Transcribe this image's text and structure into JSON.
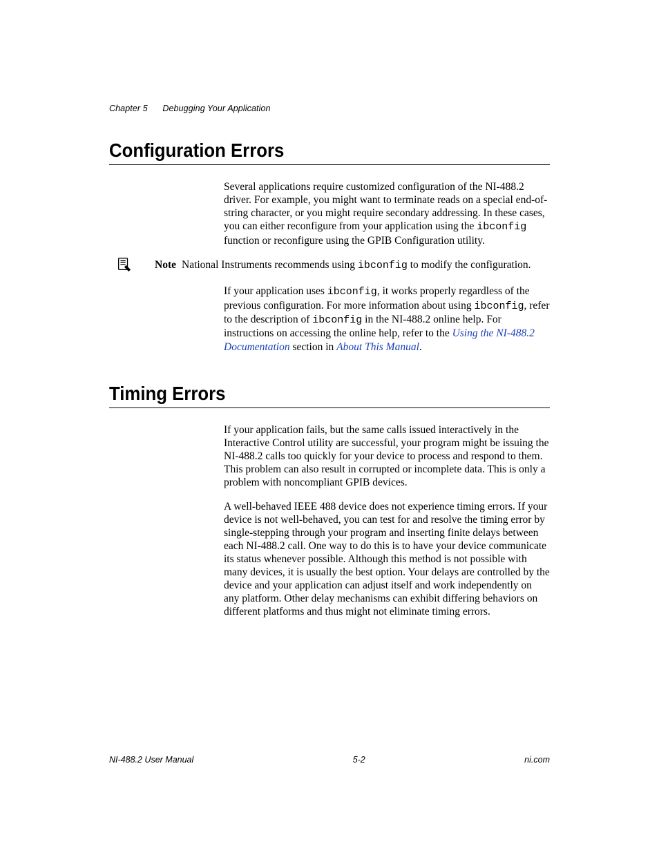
{
  "header": {
    "chapter": "Chapter 5",
    "title": "Debugging Your Application"
  },
  "sections": {
    "config": {
      "heading": "Configuration Errors",
      "p1_a": "Several applications require customized configuration of the NI-488.2 driver. For example, you might want to terminate reads on a special end-of-string character, or you might require secondary addressing. In these cases, you can either reconfigure from your application using the ",
      "p1_code": "ibconfig",
      "p1_b": " function or reconfigure using the GPIB Configuration utility.",
      "note_label": "Note",
      "note_a": "National Instruments recommends using ",
      "note_code": "ibconfig",
      "note_b": " to modify the configuration.",
      "p2_a": "If your application uses ",
      "p2_code1": "ibconfig",
      "p2_b": ", it works properly regardless of the previous configuration. For more information about using ",
      "p2_code2": "ibconfig",
      "p2_c": ", refer to the description of ",
      "p2_code3": "ibconfig",
      "p2_d": " in the NI-488.2 online help. For instructions on accessing the online help, refer to the ",
      "p2_link1": "Using the NI-488.2 Documentation",
      "p2_e": " section in ",
      "p2_link2": "About This Manual",
      "p2_f": "."
    },
    "timing": {
      "heading": "Timing Errors",
      "p1": "If your application fails, but the same calls issued interactively in the Interactive Control utility are successful, your program might be issuing the NI-488.2 calls too quickly for your device to process and respond to them. This problem can also result in corrupted or incomplete data. This is only a problem with noncompliant GPIB devices.",
      "p2": "A well-behaved IEEE 488 device does not experience timing errors. If your device is not well-behaved, you can test for and resolve the timing error by single-stepping through your program and inserting finite delays between each NI-488.2 call. One way to do this is to have your device communicate its status whenever possible. Although this method is not possible with many devices, it is usually the best option. Your delays are controlled by the device and your application can adjust itself and work independently on any platform. Other delay mechanisms can exhibit differing behaviors on different platforms and thus might not eliminate timing errors."
    }
  },
  "footer": {
    "left": "NI-488.2 User Manual",
    "center": "5-2",
    "right": "ni.com"
  }
}
